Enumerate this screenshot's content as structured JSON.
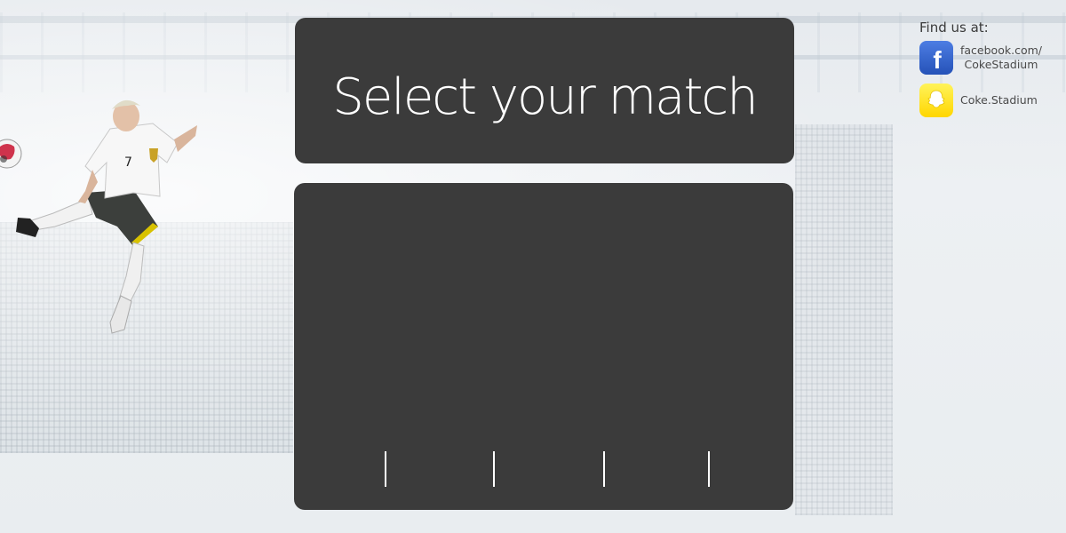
{
  "header": {
    "title": "Select your match"
  },
  "social": {
    "heading": "Find us at:",
    "facebook": {
      "icon": "facebook-icon",
      "line1": "facebook.com/",
      "line2": "CokeStadium",
      "color": "#3a68cf"
    },
    "snapchat": {
      "icon": "snapchat-icon",
      "label": "Coke.Stadium",
      "color": "#ffe419"
    }
  },
  "matches": {
    "items": []
  },
  "colors": {
    "panel": "#3b3b3b",
    "background": "#eaedf0",
    "title_text": "#ffffff"
  }
}
